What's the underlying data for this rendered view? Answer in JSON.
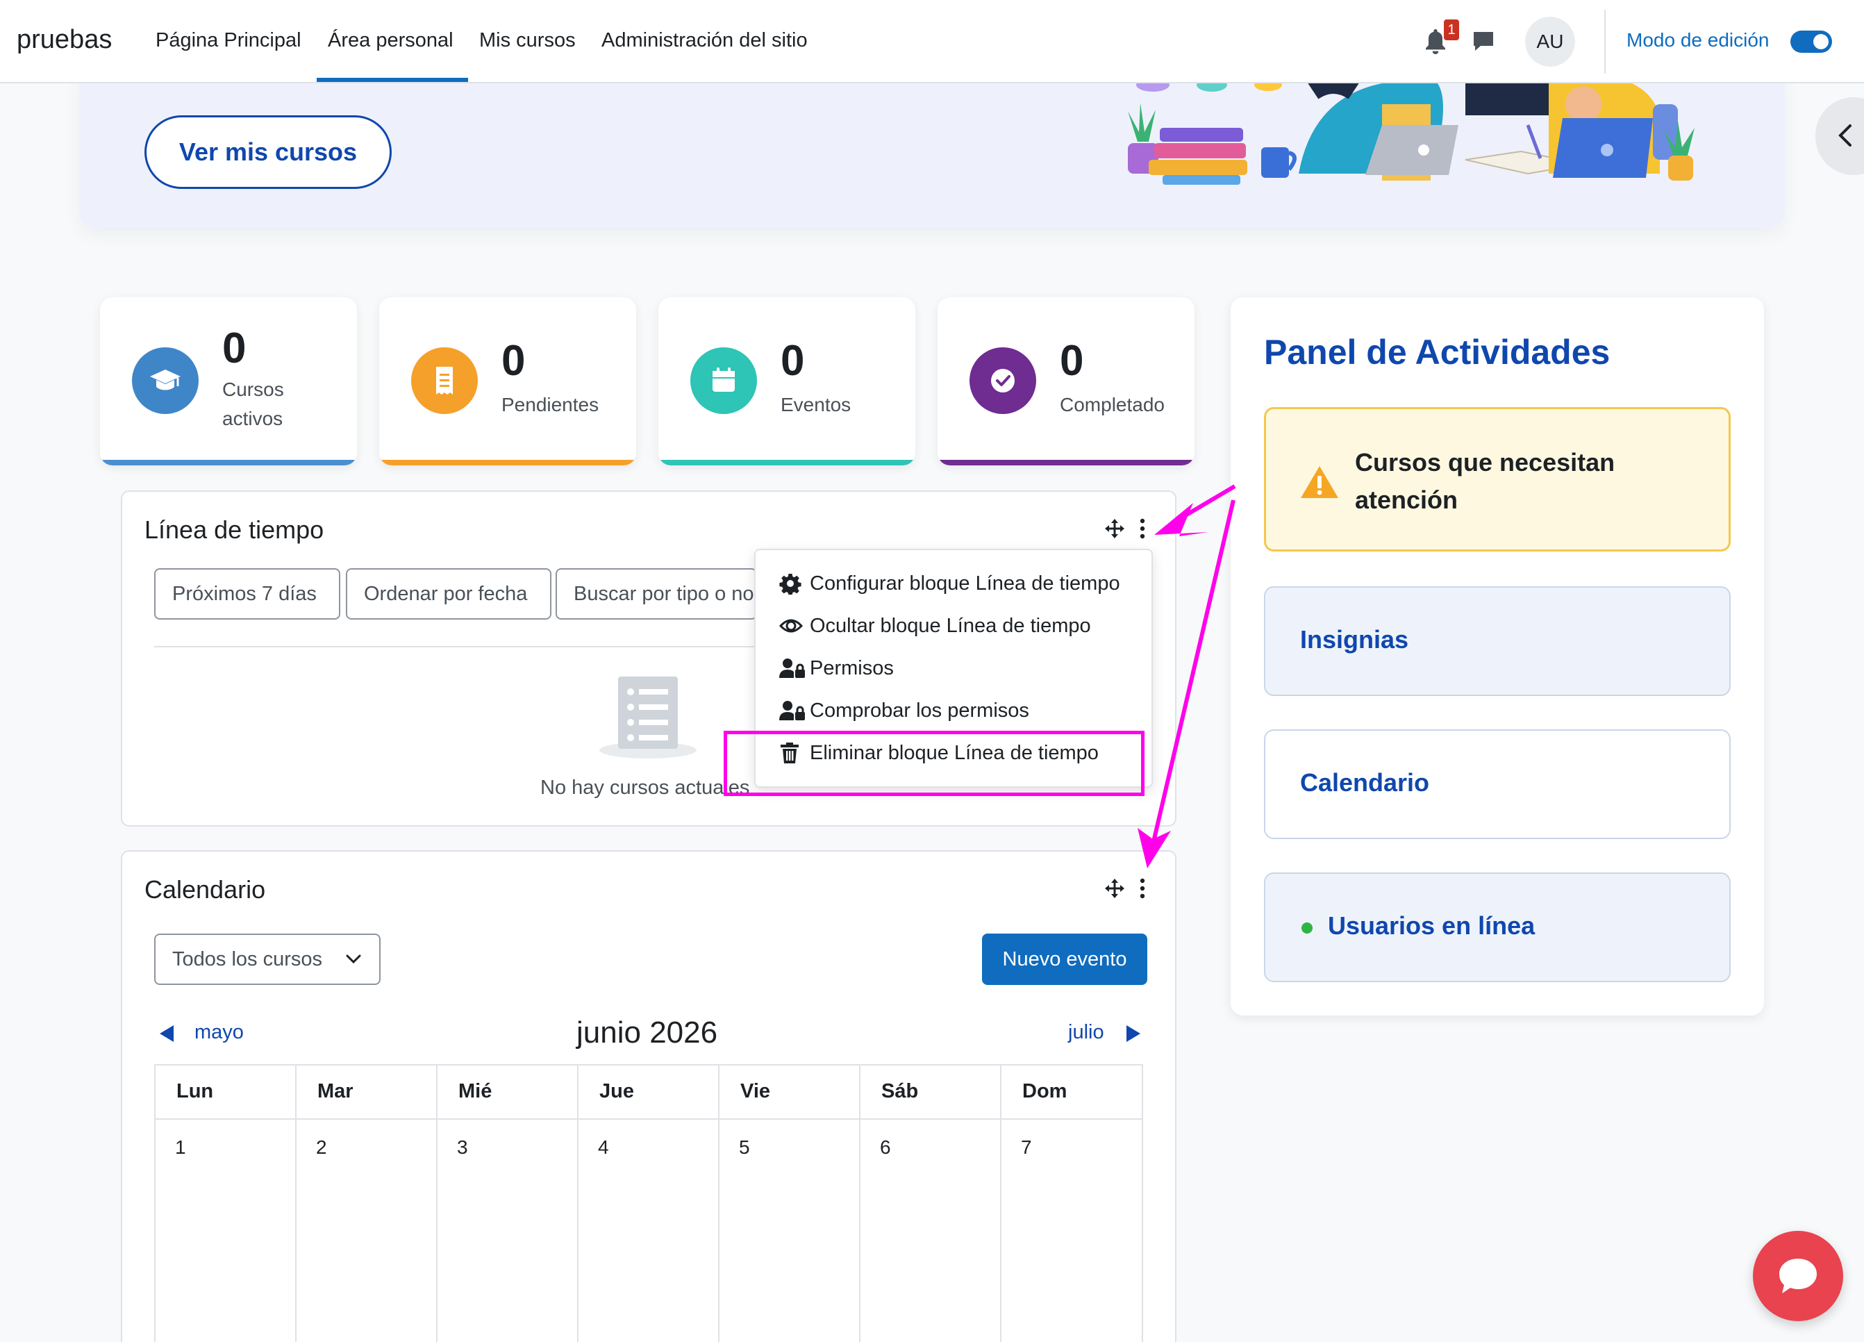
{
  "navbar": {
    "brand": "pruebas",
    "items": [
      {
        "label": "Página Principal"
      },
      {
        "label": "Área personal",
        "active": true
      },
      {
        "label": "Mis cursos"
      },
      {
        "label": "Administración del sitio"
      }
    ],
    "notification_count": "1",
    "avatar_initials": "AU",
    "edit_mode_label": "Modo de edición",
    "edit_mode_on": true
  },
  "hero": {
    "button_label": "Ver mis cursos"
  },
  "stats": [
    {
      "value": "0",
      "label": "Cursos activos",
      "color": "#3f86c8",
      "bar_color": "#4a8fd0",
      "icon": "graduation-cap-icon"
    },
    {
      "value": "0",
      "label": "Pendientes",
      "color": "#f5a02b",
      "bar_color": "#f5a02b",
      "icon": "receipt-icon"
    },
    {
      "value": "0",
      "label": "Eventos",
      "color": "#2ec4b6",
      "bar_color": "#2ec4b6",
      "icon": "calendar-icon"
    },
    {
      "value": "0",
      "label": "Completado",
      "color": "#6f2c91",
      "bar_color": "#6f2c91",
      "icon": "check-circle-icon"
    }
  ],
  "timeline": {
    "title": "Línea de tiempo",
    "filter_days": "Próximos 7 días",
    "sort": "Ordenar por fecha",
    "search_placeholder": "Buscar por tipo o nombre de actividad",
    "empty_text": "No hay cursos actuales",
    "menu": [
      {
        "label": "Configurar bloque Línea de tiempo",
        "icon": "gear-icon"
      },
      {
        "label": "Ocultar bloque Línea de tiempo",
        "icon": "eye-icon"
      },
      {
        "label": "Permisos",
        "icon": "user-lock-icon"
      },
      {
        "label": "Comprobar los permisos",
        "icon": "user-lock-icon"
      },
      {
        "label": "Eliminar bloque Línea de tiempo",
        "icon": "trash-icon"
      }
    ]
  },
  "calendar": {
    "title": "Calendario",
    "course_filter": "Todos los cursos",
    "new_event": "Nuevo evento",
    "prev_month": "mayo",
    "current_month": "junio 2026",
    "next_month": "julio",
    "weekdays": [
      "Lun",
      "Mar",
      "Mié",
      "Jue",
      "Vie",
      "Sáb",
      "Dom"
    ],
    "first_week": [
      "1",
      "2",
      "3",
      "4",
      "5",
      "6",
      "7"
    ]
  },
  "panel": {
    "title": "Panel de Actividades",
    "attention": "Cursos que necesitan atención",
    "badges": "Insignias",
    "calendar": "Calendario",
    "online_users": "Usuarios en línea"
  },
  "colors": {
    "primary": "#0f6cbf",
    "heading_blue": "#0f47ad",
    "annotation": "#ff00ea",
    "fab": "#e8434e"
  }
}
